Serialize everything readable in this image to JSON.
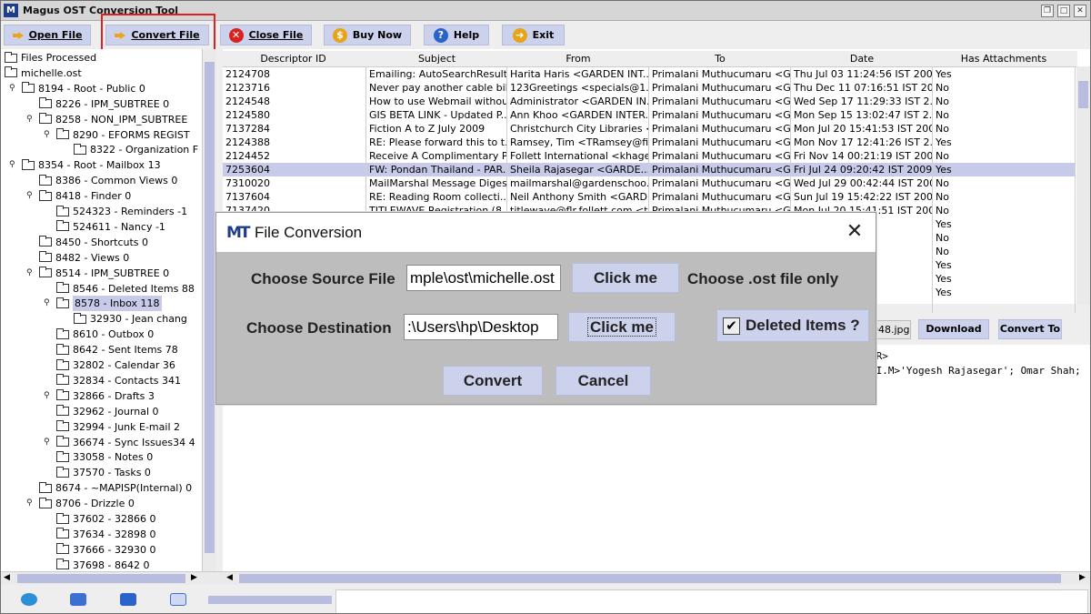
{
  "window": {
    "title": "Magus OST Conversion Tool"
  },
  "toolbar": {
    "open_file": "Open File",
    "convert_file": "Convert File",
    "close_file": "Close File",
    "buy_now": "Buy Now",
    "help": "Help",
    "exit": "Exit"
  },
  "tree": {
    "items": [
      {
        "label": "Files Processed",
        "depth": 0,
        "expander": ""
      },
      {
        "label": "michelle.ost",
        "depth": 0,
        "expander": "key"
      },
      {
        "label": "8194 - Root - Public 0",
        "depth": 1,
        "expander": "key"
      },
      {
        "label": "8226 - IPM_SUBTREE 0",
        "depth": 2,
        "expander": ""
      },
      {
        "label": "8258 - NON_IPM_SUBTREE",
        "depth": 2,
        "expander": "key"
      },
      {
        "label": "8290 - EFORMS REGIST",
        "depth": 3,
        "expander": "key"
      },
      {
        "label": "8322 - Organization F",
        "depth": 4,
        "expander": ""
      },
      {
        "label": "8354 - Root - Mailbox 13",
        "depth": 1,
        "expander": "key"
      },
      {
        "label": "8386 - Common Views 0",
        "depth": 2,
        "expander": ""
      },
      {
        "label": "8418 - Finder 0",
        "depth": 2,
        "expander": "key"
      },
      {
        "label": "524323 - Reminders -1",
        "depth": 3,
        "expander": ""
      },
      {
        "label": "524611 - Nancy -1",
        "depth": 3,
        "expander": ""
      },
      {
        "label": "8450 - Shortcuts 0",
        "depth": 2,
        "expander": ""
      },
      {
        "label": "8482 - Views 0",
        "depth": 2,
        "expander": ""
      },
      {
        "label": "8514 - IPM_SUBTREE 0",
        "depth": 2,
        "expander": "key"
      },
      {
        "label": "8546 - Deleted Items 88",
        "depth": 3,
        "expander": ""
      },
      {
        "label": "8578 - Inbox 118",
        "depth": 3,
        "expander": "key",
        "selected": true
      },
      {
        "label": "32930 - Jean chang",
        "depth": 4,
        "expander": ""
      },
      {
        "label": "8610 - Outbox 0",
        "depth": 3,
        "expander": ""
      },
      {
        "label": "8642 - Sent Items 78",
        "depth": 3,
        "expander": ""
      },
      {
        "label": "32802 - Calendar 36",
        "depth": 3,
        "expander": ""
      },
      {
        "label": "32834 - Contacts 341",
        "depth": 3,
        "expander": ""
      },
      {
        "label": "32866 - Drafts 3",
        "depth": 3,
        "expander": "key"
      },
      {
        "label": "32962 - Journal 0",
        "depth": 3,
        "expander": ""
      },
      {
        "label": "32994 - Junk E-mail 2",
        "depth": 3,
        "expander": ""
      },
      {
        "label": "36674 - Sync Issues34 4",
        "depth": 3,
        "expander": "key"
      },
      {
        "label": "33058 - Notes 0",
        "depth": 3,
        "expander": ""
      },
      {
        "label": "37570 - Tasks 0",
        "depth": 3,
        "expander": ""
      },
      {
        "label": "8674 - ~MAPISP(Internal) 0",
        "depth": 2,
        "expander": ""
      },
      {
        "label": "8706 - Drizzle 0",
        "depth": 2,
        "expander": "key"
      },
      {
        "label": "37602 - 32866 0",
        "depth": 3,
        "expander": ""
      },
      {
        "label": "37634 - 32898 0",
        "depth": 3,
        "expander": ""
      },
      {
        "label": "37666 - 32930 0",
        "depth": 3,
        "expander": ""
      },
      {
        "label": "37698 - 8642 0",
        "depth": 3,
        "expander": ""
      }
    ]
  },
  "table": {
    "headers": [
      "Descriptor ID",
      "Subject",
      "From",
      "To",
      "Date",
      "Has Attachments"
    ],
    "rows": [
      [
        "2124708",
        "Emailing: AutoSearchResults",
        "Harita Haris <GARDEN INT...",
        "Primalani Muthucumaru <G...",
        "Thu Jul 03 11:24:56 IST 2008",
        "Yes"
      ],
      [
        "2123716",
        "Never pay another cable bill ...",
        "123Greetings <specials@1...",
        "Primalani Muthucumaru <G...",
        "Thu Dec 11 07:16:51 IST 20...",
        "No"
      ],
      [
        "2124548",
        "How to use Webmail withou...",
        "Administrator <GARDEN IN...",
        "Primalani Muthucumaru <G...",
        "Wed Sep 17 11:29:33 IST 2...",
        "No"
      ],
      [
        "2124580",
        "GIS BETA LINK - Updated P...",
        "Ann Khoo <GARDEN INTER...",
        "Primalani Muthucumaru <G...",
        "Mon Sep 15 13:02:47 IST 2...",
        "No"
      ],
      [
        "7137284",
        "Fiction A to Z July 2009",
        "Christchurch City Libraries <...",
        "Primalani Muthucumaru <G...",
        "Mon Jul 20 15:41:53 IST 2009",
        "No"
      ],
      [
        "2124388",
        "RE: Please forward this to t...",
        "Ramsey, Tim <TRamsey@fi...",
        "Primalani Muthucumaru <G...",
        "Mon Nov 17 12:41:26 IST 2...",
        "Yes"
      ],
      [
        "2124452",
        "Receive A Complimentary P...",
        "Follett International <khagen...",
        "Primalani Muthucumaru <G...",
        "Fri Nov 14 00:21:19 IST 2008",
        "No"
      ],
      [
        "7253604",
        "FW: Pondan Thailand - PAR...",
        "Sheila Rajasegar <GARDE...",
        "Primalani Muthucumaru <G...",
        "Fri Jul 24 09:20:42 IST 2009",
        "Yes"
      ],
      [
        "7310020",
        "MailMarshal Message Digest",
        "mailmarshal@gardenschoo...",
        "Primalani Muthucumaru <G...",
        "Wed Jul 29 00:42:44 IST 2009",
        "No"
      ],
      [
        "7137604",
        "RE: Reading Room collecti...",
        "Neil Anthony Smith <GARDE...",
        "Primalani Muthucumaru <G...",
        "Sun Jul 19 15:42:22 IST 2009",
        "No"
      ],
      [
        "7137420",
        "TITLEWAVE Registration (8...",
        "titlewave@flr.follett.com <titl...",
        "Primalani Muthucumaru <G...",
        "Mon Jul 20 15:41:51 IST 2009",
        "No"
      ],
      [
        "",
        "",
        "",
        "",
        "...32 IST 2009",
        "Yes"
      ],
      [
        "",
        "",
        "",
        "",
        "... IST 2009",
        "No"
      ],
      [
        "",
        "",
        "",
        "",
        "...4 IST 2009",
        "No"
      ],
      [
        "",
        "",
        "",
        "",
        "...20 IST 2009",
        "Yes"
      ],
      [
        "",
        "",
        "",
        "",
        "...20 IST 2009",
        "Yes"
      ],
      [
        "",
        "",
        "",
        "",
        "...08 IST 2009",
        "Yes"
      ],
      [
        "",
        "",
        "",
        "",
        "...",
        ""
      ]
    ],
    "selected_row": 7
  },
  "attachment": {
    "file": "048.jpg",
    "download": "Download",
    "convert_to": "Convert To"
  },
  "preview": {
    "lines": [
      ".R>",
      "NI.M>'Yogesh Rajasegar'; Omar Shah;"
    ]
  },
  "dialog": {
    "title": "File Conversion",
    "source_label": "Choose Source File",
    "source_value": "mple\\ost\\michelle.ost",
    "source_button": "Click me",
    "source_hint": "Choose .ost file only",
    "dest_label": "Choose Destination",
    "dest_value": ":\\Users\\hp\\Desktop",
    "dest_button": "Click me",
    "deleted_items_label": "Deleted Items ?",
    "deleted_items_checked": true,
    "check_mark": "✔",
    "convert": "Convert",
    "cancel": "Cancel"
  },
  "colors": {
    "button_bg": "#ccd1ec",
    "selection": "#c7cae9",
    "highlight_box": "#e02020"
  }
}
